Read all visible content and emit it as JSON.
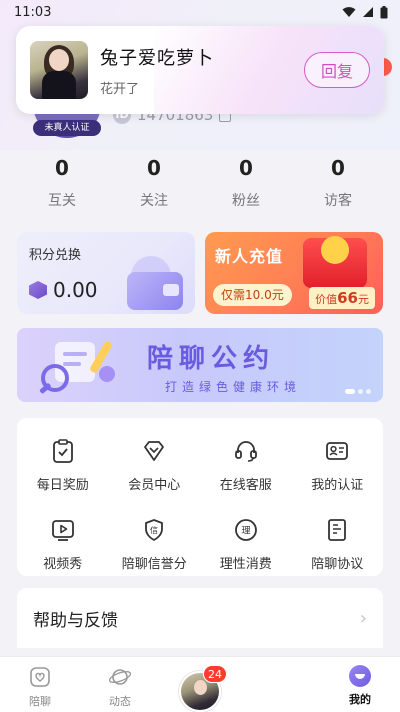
{
  "status_bar": {
    "time": "11:03"
  },
  "notification": {
    "name": "兔子爱吃萝卜",
    "message": "花开了",
    "reply_label": "回复"
  },
  "profile": {
    "badge": "未真人认证",
    "id_tag": "ID",
    "id": "14701863"
  },
  "stats": [
    {
      "value": "0",
      "label": "互关"
    },
    {
      "value": "0",
      "label": "关注"
    },
    {
      "value": "0",
      "label": "粉丝"
    },
    {
      "value": "0",
      "label": "访客"
    }
  ],
  "points_card": {
    "title": "积分兑换",
    "value": "0.00"
  },
  "recharge_card": {
    "title": "新人充值",
    "price": "仅需10.0元",
    "value_prefix": "价值",
    "value_amount": "66",
    "value_suffix": "元"
  },
  "banner": {
    "title": "陪聊公约",
    "subtitle": "打造绿色健康环境"
  },
  "features": [
    {
      "label": "每日奖励",
      "icon": "clipboard-reward-icon"
    },
    {
      "label": "会员中心",
      "icon": "diamond-icon"
    },
    {
      "label": "在线客服",
      "icon": "headset-icon"
    },
    {
      "label": "我的认证",
      "icon": "id-card-icon"
    },
    {
      "label": "视频秀",
      "icon": "video-play-icon"
    },
    {
      "label": "陪聊信誉分",
      "icon": "credit-shield-icon"
    },
    {
      "label": "理性消费",
      "icon": "rational-icon"
    },
    {
      "label": "陪聊协议",
      "icon": "agreement-doc-icon"
    }
  ],
  "help": {
    "label": "帮助与反馈"
  },
  "bottom_nav": {
    "items": [
      {
        "label": "陪聊",
        "icon": "heart-chat-icon"
      },
      {
        "label": "动态",
        "icon": "planet-icon"
      },
      {
        "label": "我的",
        "icon": "profile-icon"
      }
    ],
    "center_badge": "24"
  }
}
